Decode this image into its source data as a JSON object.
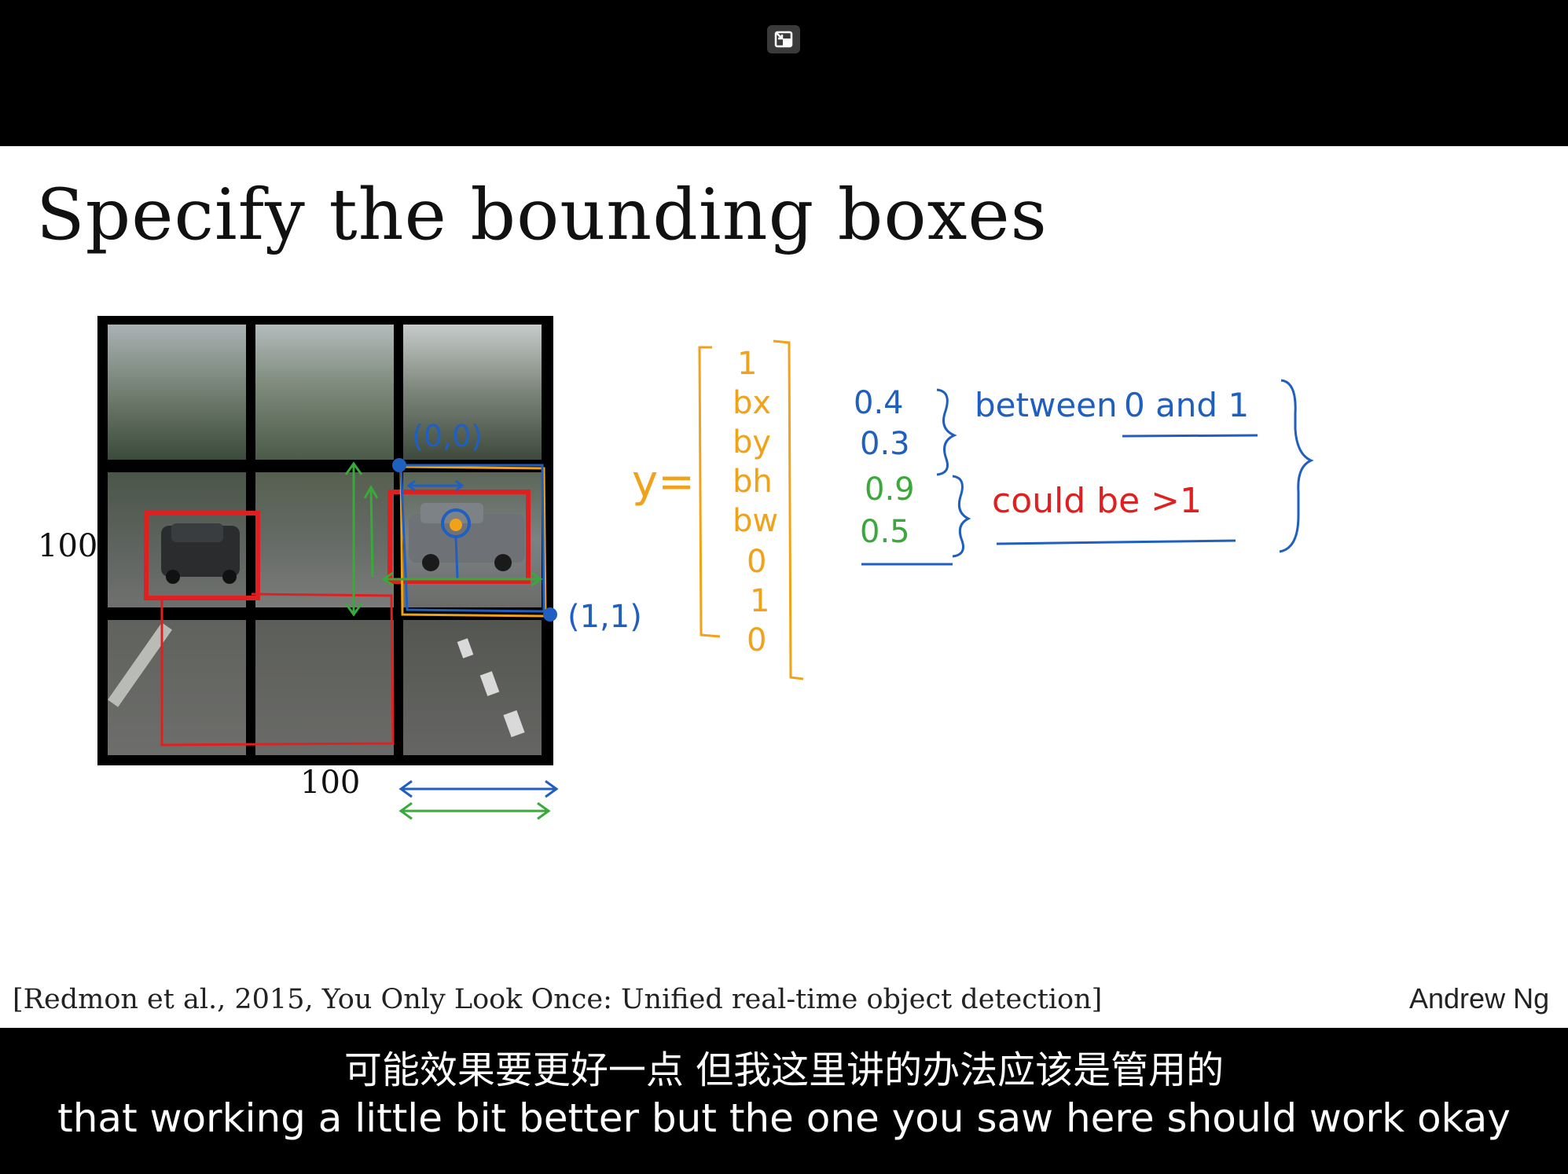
{
  "slide": {
    "title": "Specify the bounding boxes",
    "grid_label_left": "100",
    "grid_label_bottom": "100",
    "citation": "[Redmon et al., 2015, You Only Look Once: Unified real-time object detection]",
    "author": "Andrew Ng"
  },
  "annotations": {
    "origin": "(0,0)",
    "corner": "(1,1)",
    "y_label": "y=",
    "vector": [
      "1",
      "bx",
      "by",
      "bh",
      "bw",
      "0",
      "1",
      "0"
    ],
    "values": [
      "0.4",
      "0.3",
      "0.9",
      "0.5"
    ],
    "note_between": "between",
    "note_range": "0 and 1",
    "note_could_be": "could be >1"
  },
  "subtitles": {
    "zh": "可能效果要更好一点 但我这里讲的办法应该是管用的",
    "en": "that working a little bit better but the one you saw here should work okay"
  },
  "colors": {
    "annotation_blue": "#1f5fbf",
    "annotation_green": "#3aa83a",
    "annotation_orange": "#f0a21a",
    "annotation_red": "#e02020"
  },
  "icons": {
    "player_control": "exit-fullscreen-icon"
  }
}
